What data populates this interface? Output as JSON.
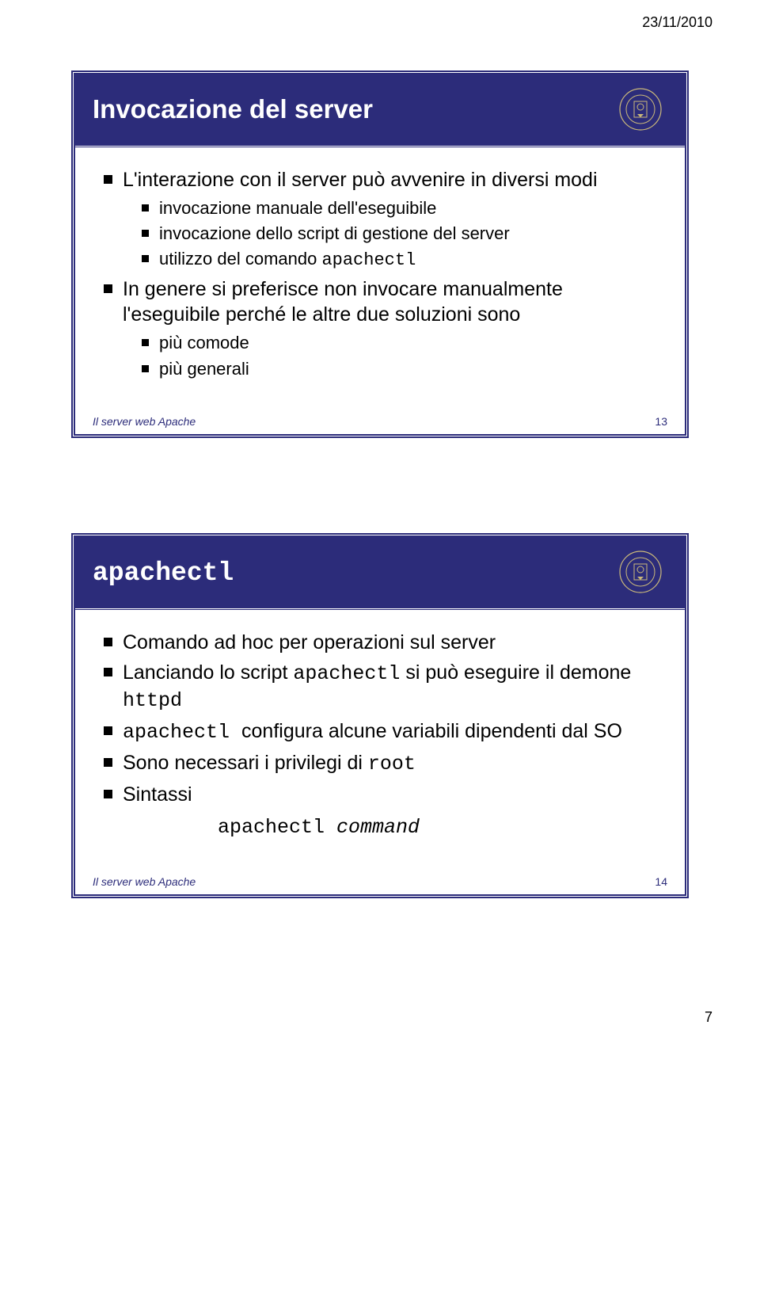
{
  "dateHeader": "23/11/2010",
  "pageNumber": "7",
  "slide1": {
    "title": "Invocazione del server",
    "p1": "L'interazione con il server può avvenire in diversi modi",
    "s1": "invocazione manuale dell'eseguibile",
    "s2": "invocazione dello script di gestione del server",
    "s3_pre": "utilizzo del comando ",
    "s3_mono": "apachectl",
    "p2": "In genere si preferisce non invocare manualmente l'eseguibile perché le altre due soluzioni sono",
    "s4": "più comode",
    "s5": "più generali",
    "footLabel": "Il server web Apache",
    "footNum": "13"
  },
  "slide2": {
    "title": "apachectl",
    "p1": "Comando ad hoc per operazioni sul server",
    "p2_pre": "Lanciando lo script ",
    "p2_mono": "apachectl",
    "p2_mid": " si può eseguire il demone ",
    "p2_mono2": "httpd",
    "p3_mono": "apachectl ",
    "p3_rest": " configura alcune variabili dipendenti dal SO",
    "p4_pre": "Sono necessari i privilegi di ",
    "p4_mono": "root",
    "p5": "Sintassi",
    "cmd": "apachectl ",
    "cmdItal": "command",
    "footLabel": "Il server web Apache",
    "footNum": "14"
  }
}
